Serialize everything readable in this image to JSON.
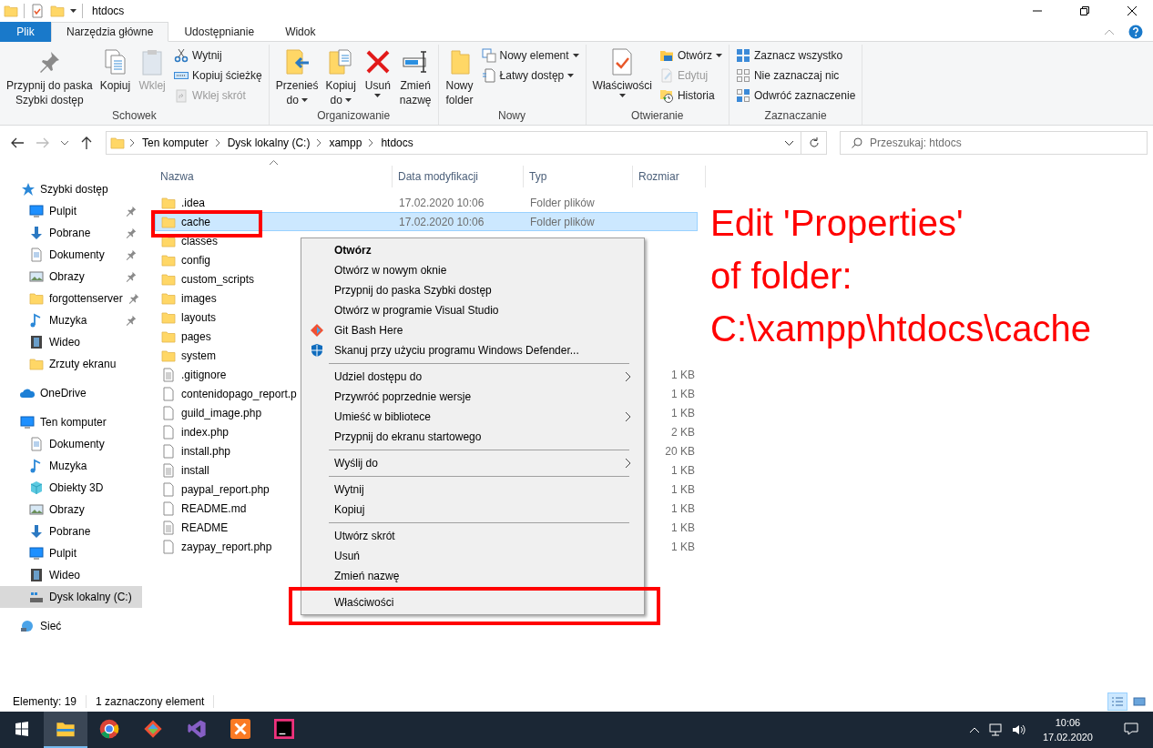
{
  "window": {
    "title": "htdocs"
  },
  "ribbon": {
    "tabs": [
      {
        "label": "Plik",
        "kind": "file",
        "selected": false
      },
      {
        "label": "Narzędzia główne",
        "kind": "tab",
        "selected": true
      },
      {
        "label": "Udostępnianie",
        "kind": "tab",
        "selected": false
      },
      {
        "label": "Widok",
        "kind": "tab",
        "selected": false
      }
    ],
    "groups": [
      {
        "label": "Schowek",
        "items": [
          {
            "kind": "large",
            "lines": [
              "Przypnij do paska",
              "Szybki dostęp"
            ],
            "menu": false,
            "disabled": false
          },
          {
            "kind": "large",
            "lines": [
              "Kopiuj"
            ],
            "menu": false,
            "disabled": false
          },
          {
            "kind": "large",
            "lines": [
              "Wklej"
            ],
            "menu": false,
            "disabled": true
          },
          {
            "kind": "small",
            "lines": [
              "Wytnij"
            ],
            "menu": false,
            "disabled": false
          },
          {
            "kind": "small",
            "lines": [
              "Kopiuj ścieżkę"
            ],
            "menu": false,
            "disabled": false
          },
          {
            "kind": "small",
            "lines": [
              "Wklej skrót"
            ],
            "menu": false,
            "disabled": true
          }
        ]
      },
      {
        "label": "Organizowanie",
        "items": [
          {
            "kind": "large",
            "lines": [
              "Przenieś",
              "do"
            ],
            "menu": true,
            "disabled": false
          },
          {
            "kind": "large",
            "lines": [
              "Kopiuj",
              "do"
            ],
            "menu": true,
            "disabled": false
          },
          {
            "kind": "large",
            "lines": [
              "Usuń"
            ],
            "menu": true,
            "disabled": false
          },
          {
            "kind": "large",
            "lines": [
              "Zmień",
              "nazwę"
            ],
            "menu": false,
            "disabled": false
          }
        ]
      },
      {
        "label": "Nowy",
        "items": [
          {
            "kind": "large",
            "lines": [
              "Nowy",
              "folder"
            ],
            "menu": false,
            "disabled": false
          },
          {
            "kind": "small",
            "lines": [
              "Nowy element"
            ],
            "menu": true,
            "disabled": false
          },
          {
            "kind": "small",
            "lines": [
              "Łatwy dostęp"
            ],
            "menu": true,
            "disabled": false
          }
        ]
      },
      {
        "label": "Otwieranie",
        "items": [
          {
            "kind": "large",
            "lines": [
              "Właściwości"
            ],
            "menu": true,
            "disabled": false
          },
          {
            "kind": "small",
            "lines": [
              "Otwórz"
            ],
            "menu": true,
            "disabled": false
          },
          {
            "kind": "small",
            "lines": [
              "Edytuj"
            ],
            "menu": false,
            "disabled": true
          },
          {
            "kind": "small",
            "lines": [
              "Historia"
            ],
            "menu": false,
            "disabled": false
          }
        ]
      },
      {
        "label": "Zaznaczanie",
        "items": [
          {
            "kind": "small",
            "lines": [
              "Zaznacz wszystko"
            ],
            "menu": false,
            "disabled": false
          },
          {
            "kind": "small",
            "lines": [
              "Nie zaznaczaj nic"
            ],
            "menu": false,
            "disabled": false
          },
          {
            "kind": "small",
            "lines": [
              "Odwróć zaznaczenie"
            ],
            "menu": false,
            "disabled": false
          }
        ]
      }
    ]
  },
  "address": {
    "back": {
      "disabled": false
    },
    "forward": {
      "disabled": true
    },
    "crumbs": [
      "Ten komputer",
      "Dysk lokalny (C:)",
      "xampp",
      "htdocs"
    ],
    "search": {
      "placeholder": "Przeszukaj: htdocs"
    }
  },
  "sidebar": {
    "items": [
      {
        "label": "Szybki dostęp",
        "selected": false,
        "children": [
          {
            "label": "Pulpit",
            "pinned": true,
            "selected": false
          },
          {
            "label": "Pobrane",
            "pinned": true,
            "selected": false
          },
          {
            "label": "Dokumenty",
            "pinned": true,
            "selected": false
          },
          {
            "label": "Obrazy",
            "pinned": true,
            "selected": false
          },
          {
            "label": "forgottenserver",
            "pinned": true,
            "selected": false
          },
          {
            "label": "Muzyka",
            "pinned": true,
            "selected": false
          },
          {
            "label": "Wideo",
            "pinned": false,
            "selected": false
          },
          {
            "label": "Zrzuty ekranu",
            "pinned": false,
            "selected": false
          }
        ]
      },
      {
        "label": "OneDrive",
        "selected": false
      },
      {
        "label": "Ten komputer",
        "selected": false,
        "children": [
          {
            "label": "Dokumenty",
            "selected": false
          },
          {
            "label": "Muzyka",
            "selected": false
          },
          {
            "label": "Obiekty 3D",
            "selected": false
          },
          {
            "label": "Obrazy",
            "selected": false
          },
          {
            "label": "Pobrane",
            "selected": false
          },
          {
            "label": "Pulpit",
            "selected": false
          },
          {
            "label": "Wideo",
            "selected": false
          },
          {
            "label": "Dysk lokalny (C:)",
            "selected": true
          }
        ]
      },
      {
        "label": "Sieć",
        "selected": false
      }
    ]
  },
  "table": {
    "columns": [
      "Nazwa",
      "Data modyfikacji",
      "Typ",
      "Rozmiar"
    ],
    "rows": [
      {
        "kind": "folder",
        "name": ".idea",
        "date": "17.02.2020 10:06",
        "type": "Folder plików",
        "selected": false
      },
      {
        "kind": "folder",
        "name": "cache",
        "date": "17.02.2020 10:06",
        "type": "Folder plików",
        "selected": true
      },
      {
        "kind": "folder",
        "name": "classes",
        "selected": false
      },
      {
        "kind": "folder",
        "name": "config",
        "selected": false
      },
      {
        "kind": "folder",
        "name": "custom_scripts",
        "selected": false
      },
      {
        "kind": "folder",
        "name": "images",
        "selected": false
      },
      {
        "kind": "folder",
        "name": "layouts",
        "selected": false
      },
      {
        "kind": "folder",
        "name": "pages",
        "selected": false
      },
      {
        "kind": "folder",
        "name": "system",
        "selected": false
      },
      {
        "kind": "text",
        "name": ".gitignore",
        "size": "1 KB",
        "selected": false
      },
      {
        "kind": "file",
        "name": "contenidopago_report.p",
        "size": "1 KB",
        "selected": false
      },
      {
        "kind": "file",
        "name": "guild_image.php",
        "size": "1 KB",
        "selected": false
      },
      {
        "kind": "file",
        "name": "index.php",
        "size": "2 KB",
        "selected": false
      },
      {
        "kind": "file",
        "name": "install.php",
        "size": "20 KB",
        "selected": false
      },
      {
        "kind": "text",
        "name": "install",
        "size": "1 KB",
        "selected": false
      },
      {
        "kind": "file",
        "name": "paypal_report.php",
        "size": "1 KB",
        "selected": false
      },
      {
        "kind": "file",
        "name": "README.md",
        "size": "1 KB",
        "selected": false
      },
      {
        "kind": "text",
        "name": "README",
        "size": "1 KB",
        "selected": false
      },
      {
        "kind": "file",
        "name": "zaypay_report.php",
        "size": "1 KB",
        "selected": false
      }
    ]
  },
  "context_menu": {
    "sections": [
      [
        {
          "label": "Otwórz",
          "bold": true,
          "submenu": false
        },
        {
          "label": "Otwórz w nowym oknie",
          "bold": false,
          "submenu": false
        },
        {
          "label": "Przypnij do paska Szybki dostęp",
          "bold": false,
          "submenu": false
        },
        {
          "label": "Otwórz w programie Visual Studio",
          "bold": false,
          "submenu": false
        },
        {
          "label": "Git Bash Here",
          "bold": false,
          "submenu": false
        },
        {
          "label": "Skanuj przy użyciu programu Windows Defender...",
          "bold": false,
          "submenu": false
        }
      ],
      [
        {
          "label": "Udziel dostępu do",
          "bold": false,
          "submenu": true
        },
        {
          "label": "Przywróć poprzednie wersje",
          "bold": false,
          "submenu": false
        },
        {
          "label": "Umieść w bibliotece",
          "bold": false,
          "submenu": true
        },
        {
          "label": "Przypnij do ekranu startowego",
          "bold": false,
          "submenu": false
        }
      ],
      [
        {
          "label": "Wyślij do",
          "bold": false,
          "submenu": true
        }
      ],
      [
        {
          "label": "Wytnij",
          "bold": false,
          "submenu": false
        },
        {
          "label": "Kopiuj",
          "bold": false,
          "submenu": false
        }
      ],
      [
        {
          "label": "Utwórz skrót",
          "bold": false,
          "submenu": false
        },
        {
          "label": "Usuń",
          "bold": false,
          "submenu": false
        },
        {
          "label": "Zmień nazwę",
          "bold": false,
          "submenu": false
        }
      ],
      [
        {
          "label": "Właściwości",
          "bold": false,
          "submenu": false
        }
      ]
    ]
  },
  "annotation": {
    "lines": [
      "Edit 'Properties'",
      "of folder:",
      "C:\\xampp\\htdocs\\cache"
    ]
  },
  "status_bar": {
    "count": "Elementy: 19",
    "selection": "1 zaznaczony element",
    "views": [
      {
        "kind": "details",
        "selected": true
      },
      {
        "kind": "tiles",
        "selected": false
      }
    ]
  },
  "taskbar": {
    "apps": [
      {
        "selected": true
      },
      {
        "selected": false
      },
      {
        "selected": false
      },
      {
        "selected": false
      },
      {
        "selected": false
      },
      {
        "selected": false
      }
    ],
    "time": "10:06",
    "date": "17.02.2020"
  }
}
